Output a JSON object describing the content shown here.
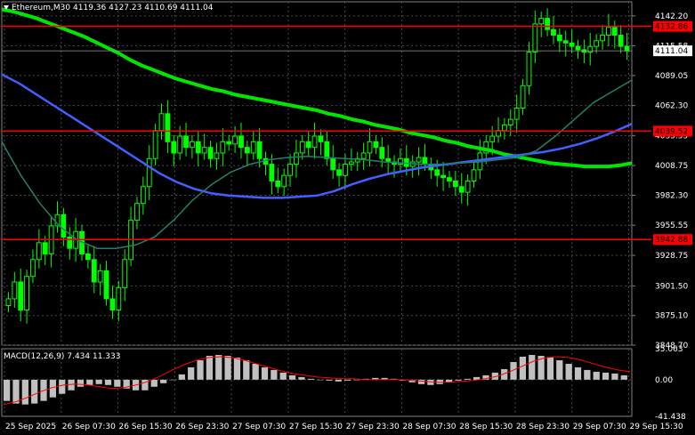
{
  "header": {
    "symbol_timeframe": "Ethereum,M30",
    "ohlc": "4119.36 4127.23 4110.69 4111.04"
  },
  "macd_header": {
    "label": "MACD(12,26,9)",
    "values": "7.434 11.333"
  },
  "colors": {
    "background": "#000000",
    "grid": "#4a4a4a",
    "price_line": "#ff0000",
    "candles": "#00ff00",
    "ma_slow": "#00e600",
    "ma_mid": "#4060ff",
    "ma_fast": "#208070",
    "macd_hist": "#c0c0c0",
    "macd_signal": "#ff0000"
  },
  "chart_data": [
    {
      "type": "candlestick",
      "title": "Ethereum,M30",
      "y_ticks": [
        "4142.20",
        "4115.58",
        "4089.05",
        "4062.30",
        "4035.55",
        "4008.75",
        "3982.30",
        "3955.55",
        "3928.75",
        "3901.50",
        "3875.10",
        "3848.70"
      ],
      "ylim": [
        3848.7,
        4150.0
      ],
      "x_ticks": [
        "25 Sep 2025",
        "26 Sep 07:30",
        "26 Sep 15:30",
        "26 Sep 23:30",
        "27 Sep 07:30",
        "27 Sep 15:30",
        "27 Sep 23:30",
        "28 Sep 07:30",
        "28 Sep 15:30",
        "28 Sep 23:30",
        "29 Sep 07:30",
        "29 Sep 15:30"
      ],
      "current_price": "4111.04",
      "horizontal_levels": [
        "4132.86",
        "4039.52",
        "3942.88"
      ],
      "close_series": [
        3890,
        3905,
        3880,
        3910,
        3925,
        3940,
        3930,
        3955,
        3965,
        3945,
        3935,
        3950,
        3930,
        3925,
        3905,
        3915,
        3890,
        3880,
        3900,
        3925,
        3960,
        3975,
        3990,
        4015,
        4040,
        4055,
        4030,
        4020,
        4035,
        4025,
        4030,
        4020,
        4025,
        4015,
        4020,
        4030,
        4028,
        4035,
        4025,
        4020,
        4030,
        4015,
        4010,
        3995,
        3990,
        4000,
        4010,
        4020,
        4030,
        4025,
        4035,
        4030,
        4015,
        4005,
        4000,
        4010,
        4012,
        4015,
        4020,
        4030,
        4025,
        4015,
        4012,
        4010,
        4015,
        4008,
        4012,
        4016,
        4010,
        4005,
        4000,
        3998,
        3995,
        3990,
        3985,
        3995,
        4005,
        4020,
        4030,
        4035,
        4040,
        4045,
        4050,
        4060,
        4080,
        4110,
        4135,
        4140,
        4130,
        4125,
        4120,
        4118,
        4115,
        4112,
        4110,
        4115,
        4120,
        4125,
        4132,
        4125,
        4115,
        4111
      ],
      "ma_slow": [
        4148,
        4146,
        4143,
        4140,
        4136,
        4132,
        4128,
        4124,
        4119,
        4114,
        4109,
        4103,
        4098,
        4094,
        4090,
        4086,
        4083,
        4080,
        4077,
        4075,
        4072,
        4070,
        4068,
        4066,
        4064,
        4062,
        4060,
        4058,
        4055,
        4053,
        4050,
        4048,
        4045,
        4043,
        4041,
        4038,
        4036,
        4034,
        4031,
        4029,
        4026,
        4024,
        4022,
        4019,
        4017,
        4015,
        4013,
        4011,
        4010,
        4009,
        4008,
        4008,
        4008,
        4009,
        4011
      ],
      "ma_mid": [
        4090,
        4082,
        4072,
        4062,
        4052,
        4042,
        4032,
        4022,
        4012,
        4002,
        3994,
        3988,
        3984,
        3982,
        3981,
        3980,
        3980,
        3981,
        3982,
        3986,
        3992,
        3997,
        4001,
        4004,
        4007,
        4009,
        4011,
        4013,
        4015,
        4017,
        4019,
        4021,
        4024,
        4028,
        4033,
        4039,
        4046
      ],
      "ma_fast": [
        4030,
        4000,
        3975,
        3955,
        3942,
        3935,
        3935,
        3938,
        3945,
        3960,
        3978,
        3992,
        4003,
        4010,
        4014,
        4016,
        4017,
        4016,
        4015,
        4014,
        4012,
        4011,
        4010,
        4010,
        4011,
        4012,
        4014,
        4016,
        4022,
        4035,
        4050,
        4065,
        4075,
        4085
      ]
    },
    {
      "type": "bar",
      "title": "MACD(12,26,9)",
      "y_ticks": [
        "35.063",
        "0.00",
        "-41.438"
      ],
      "ylim": [
        -41.438,
        35.063
      ],
      "histogram": [
        -24,
        -27,
        -28,
        -27,
        -24,
        -20,
        -16,
        -12,
        -8,
        -6,
        -5,
        -6,
        -8,
        -10,
        -12,
        -12,
        -8,
        -4,
        0,
        6,
        14,
        22,
        27,
        28,
        27,
        25,
        22,
        18,
        14,
        11,
        8,
        5,
        3,
        1,
        0,
        -1,
        -2,
        -1,
        0,
        1,
        2,
        2,
        1,
        -1,
        -3,
        -5,
        -6,
        -5,
        -3,
        -1,
        1,
        3,
        5,
        8,
        12,
        20,
        26,
        28,
        27,
        25,
        22,
        18,
        14,
        11,
        9,
        8,
        7,
        5
      ],
      "signal": [
        -28,
        -25,
        -20,
        -14,
        -9,
        -6,
        -5,
        -6,
        -8,
        -10,
        -9,
        -6,
        -2,
        4,
        11,
        17,
        22,
        25,
        26,
        25,
        22,
        18,
        14,
        10,
        7,
        5,
        3,
        2,
        1,
        1,
        0,
        0,
        0,
        0,
        -1,
        -2,
        -3,
        -3,
        -2,
        -1,
        1,
        4,
        9,
        15,
        21,
        25,
        26,
        25,
        22,
        18,
        14,
        11,
        9
      ]
    }
  ]
}
